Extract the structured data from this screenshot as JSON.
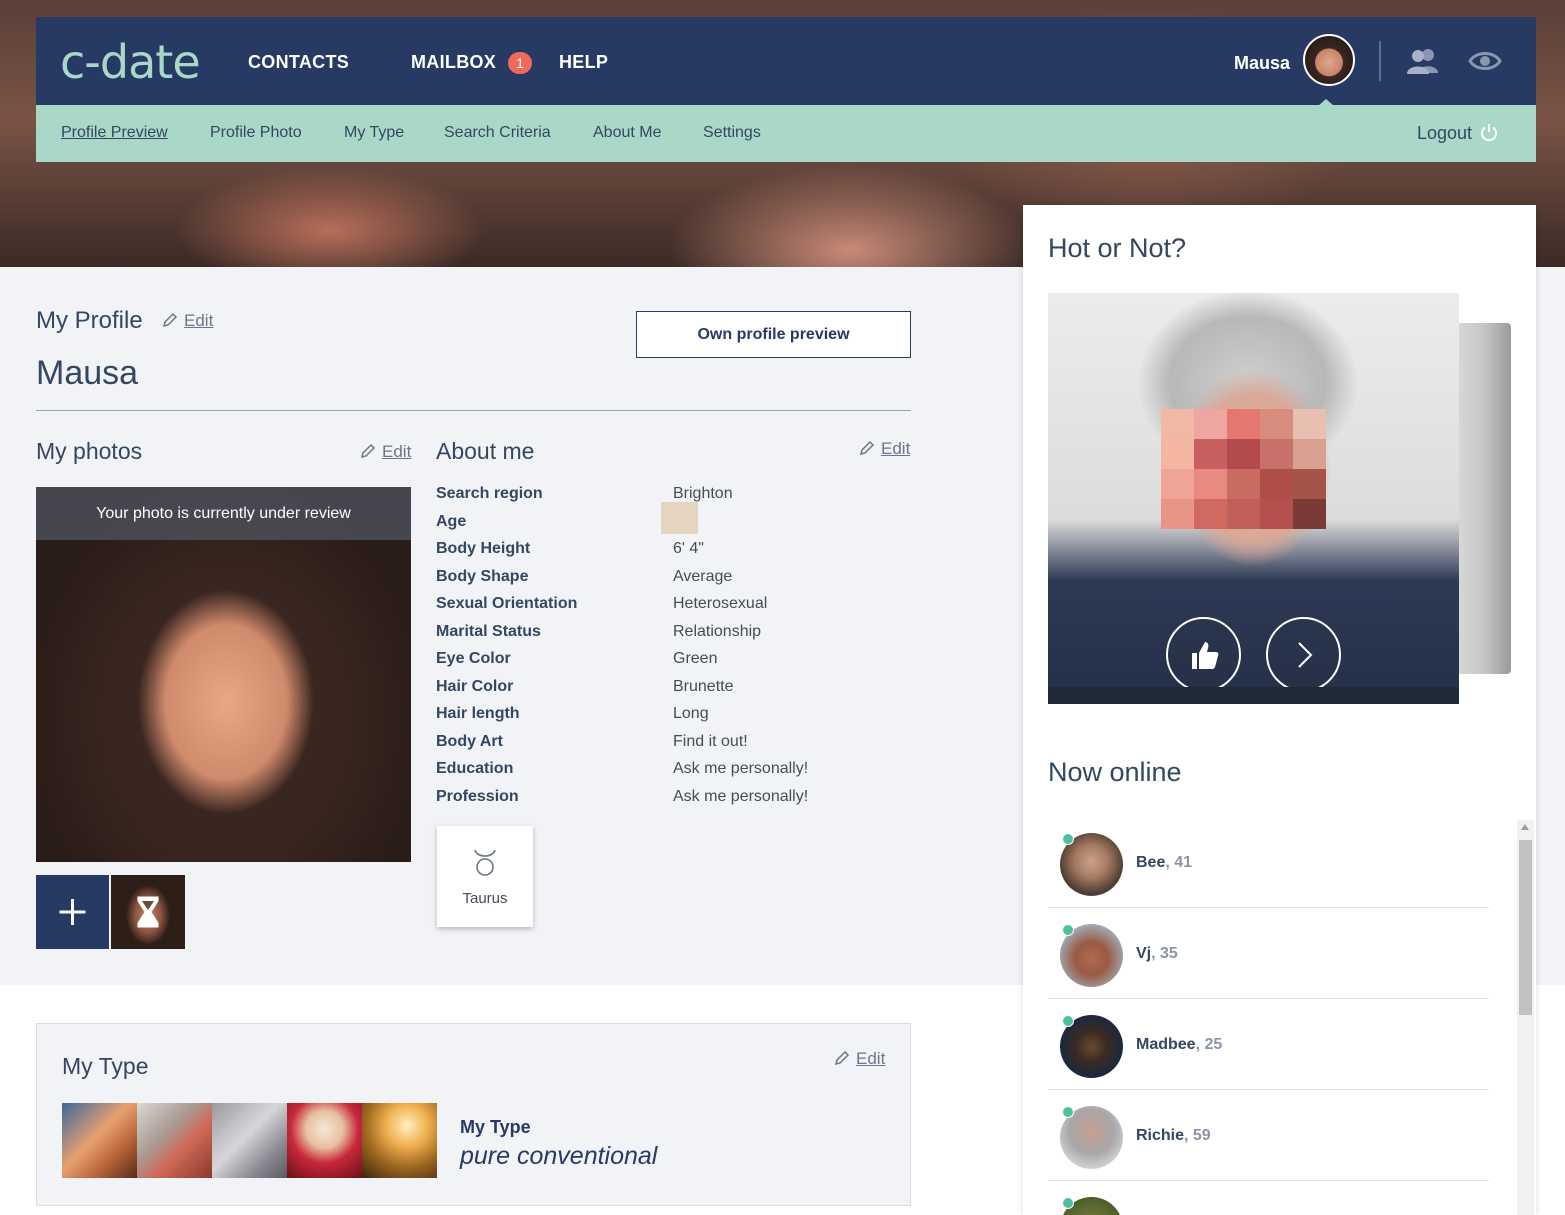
{
  "brand": {
    "logo_text": "c-date"
  },
  "topnav": {
    "links": [
      {
        "label": "CONTACTS"
      },
      {
        "label": "MAILBOX"
      },
      {
        "label": "HELP"
      }
    ],
    "mailbox_badge": "1",
    "username": "Mausa",
    "icons": [
      "users-icon",
      "eye-icon"
    ]
  },
  "subnav": {
    "items": [
      {
        "label": "Profile Preview",
        "active": true
      },
      {
        "label": "Profile Photo"
      },
      {
        "label": "My Type"
      },
      {
        "label": "Search Criteria"
      },
      {
        "label": "About Me"
      },
      {
        "label": "Settings"
      }
    ],
    "logout_label": "Logout"
  },
  "profile": {
    "heading": "My Profile",
    "edit_label": "Edit",
    "name": "Mausa",
    "preview_button": "Own profile preview"
  },
  "photos": {
    "heading": "My photos",
    "edit_label": "Edit",
    "review_text": "Your photo is currently under review"
  },
  "about": {
    "heading": "About me",
    "edit_label": "Edit",
    "rows": [
      {
        "label": "Search region",
        "value": "Brighton"
      },
      {
        "label": "Age",
        "value": ""
      },
      {
        "label": "Body Height",
        "value": "6' 4\""
      },
      {
        "label": "Body Shape",
        "value": "Average"
      },
      {
        "label": "Sexual Orientation",
        "value": "Heterosexual"
      },
      {
        "label": "Marital Status",
        "value": "Relationship"
      },
      {
        "label": "Eye Color",
        "value": "Green"
      },
      {
        "label": "Hair Color",
        "value": "Brunette"
      },
      {
        "label": "Hair length",
        "value": "Long"
      },
      {
        "label": "Body Art",
        "value": "Find it out!"
      },
      {
        "label": "Education",
        "value": "Ask me personally!"
      },
      {
        "label": "Profession",
        "value": "Ask me personally!"
      }
    ],
    "zodiac": {
      "label": "Taurus",
      "icon": "taurus-icon"
    }
  },
  "mytype": {
    "heading": "My Type",
    "edit_label": "Edit",
    "title": "My Type",
    "value": "pure conventional"
  },
  "hot_or_not": {
    "heading": "Hot or Not?",
    "buttons": [
      "thumbs-up-icon",
      "next-arrow-icon"
    ]
  },
  "now_online": {
    "heading": "Now online",
    "users": [
      {
        "name": "Bee",
        "age": "41"
      },
      {
        "name": "Vj",
        "age": "35"
      },
      {
        "name": "Madbee",
        "age": "25"
      },
      {
        "name": "Richie",
        "age": "59"
      }
    ]
  },
  "colors": {
    "nav_bg": "#263a63",
    "subnav_bg": "#a9d8c8",
    "badge": "#f06a5a",
    "online_dot": "#4fbfa0"
  }
}
